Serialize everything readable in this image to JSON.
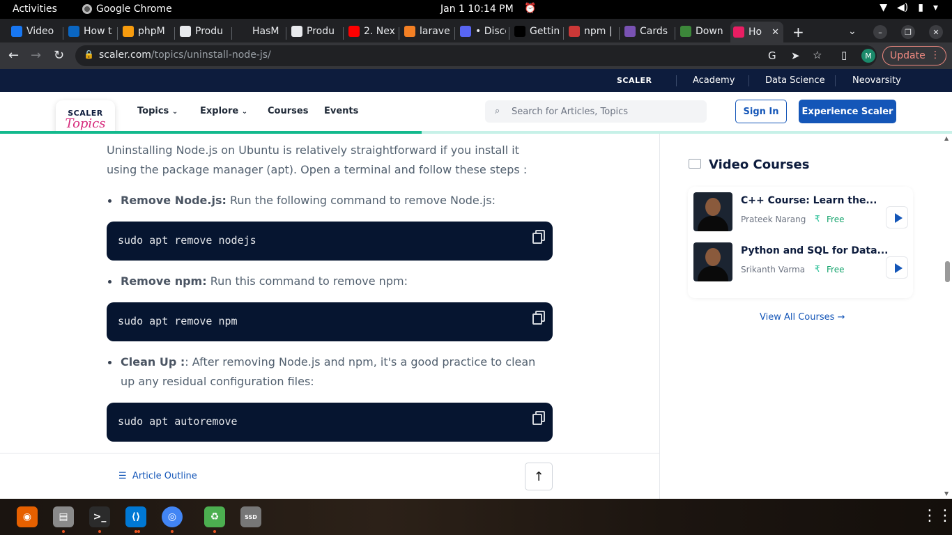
{
  "system": {
    "activities": "Activities",
    "app_name": "Google Chrome",
    "clock": "Jan 1  10:14 PM"
  },
  "tabs": [
    {
      "label": "Video",
      "favicon": "facebook-icon",
      "color": "#1877f2"
    },
    {
      "label": "How t",
      "favicon": "linkedin-icon",
      "color": "#0a66c2"
    },
    {
      "label": "phpM",
      "favicon": "phpmyadmin-icon",
      "color": "#f89c0e"
    },
    {
      "label": "Produ",
      "favicon": "page-icon",
      "color": "#e8eaed"
    },
    {
      "label": "HasM",
      "favicon": "github-icon",
      "color": "#202124"
    },
    {
      "label": "Produ",
      "favicon": "page-icon",
      "color": "#e8eaed"
    },
    {
      "label": "2. Nex",
      "favicon": "youtube-icon",
      "color": "#ff0000"
    },
    {
      "label": "larave",
      "favicon": "stackoverflow-icon",
      "color": "#f48024"
    },
    {
      "label": "• Disco",
      "favicon": "discord-icon",
      "color": "#5865f2"
    },
    {
      "label": "Gettin",
      "favicon": "nextjs-icon",
      "color": "#000000"
    },
    {
      "label": "npm |",
      "favicon": "npm-icon",
      "color": "#cb3837"
    },
    {
      "label": "Cards",
      "favicon": "bootstrap-icon",
      "color": "#7952b3"
    },
    {
      "label": "Down",
      "favicon": "nodejs-icon",
      "color": "#3c873a"
    },
    {
      "label": "Ho",
      "favicon": "scaler-topics-icon",
      "color": "#e91e63",
      "active": true
    }
  ],
  "browser": {
    "url_domain": "scaler.com",
    "url_path": "/topics/uninstall-node-js/",
    "profile_initial": "M",
    "update_label": "Update"
  },
  "site": {
    "top_brand": "SCALER",
    "top_links": [
      "Academy",
      "Data Science",
      "Neovarsity"
    ],
    "logo_line1": "SCALER",
    "logo_line2": "Topics",
    "nav": [
      "Topics",
      "Explore",
      "Courses",
      "Events"
    ],
    "search_placeholder": "Search for Articles, Topics",
    "signin": "Sign In",
    "experience": "Experience Scaler",
    "read_progress": 0.443
  },
  "article": {
    "intro": "Uninstalling Node.js on Ubuntu is relatively straightforward if you install it using the package manager (apt). Open a terminal and follow these steps :",
    "steps": [
      {
        "title": "Remove Node.js:",
        "text": " Run the following command to remove Node.js:",
        "code": "sudo apt remove nodejs"
      },
      {
        "title": "Remove npm:",
        "text": " Run this command to remove npm:",
        "code": "sudo apt remove npm"
      },
      {
        "title": "Clean Up :",
        "text": ": After removing Node.js and npm, it's a good practice to clean up any residual configuration files:",
        "code": "sudo apt autoremove"
      }
    ]
  },
  "sidebar": {
    "title": "Video Courses",
    "courses": [
      {
        "title": "C++ Course: Learn the...",
        "instructor": "Prateek Narang",
        "price": "Free"
      },
      {
        "title": "Python and SQL for Data...",
        "instructor": "Srikanth Varma",
        "price": "Free"
      }
    ],
    "view_all": "View All Courses"
  },
  "footer": {
    "outline": "Article Outline"
  },
  "dock": [
    {
      "name": "firefox-icon",
      "color": "#e66000"
    },
    {
      "name": "files-icon",
      "color": "#8a8a8a"
    },
    {
      "name": "terminal-icon",
      "color": "#2b2b2b"
    },
    {
      "name": "vscode-icon",
      "color": "#0078d4"
    },
    {
      "name": "chrome-icon",
      "color": "#4285f4"
    },
    {
      "name": "trash-icon",
      "color": "#4caf50"
    },
    {
      "name": "disk-icon",
      "color": "#777"
    }
  ]
}
